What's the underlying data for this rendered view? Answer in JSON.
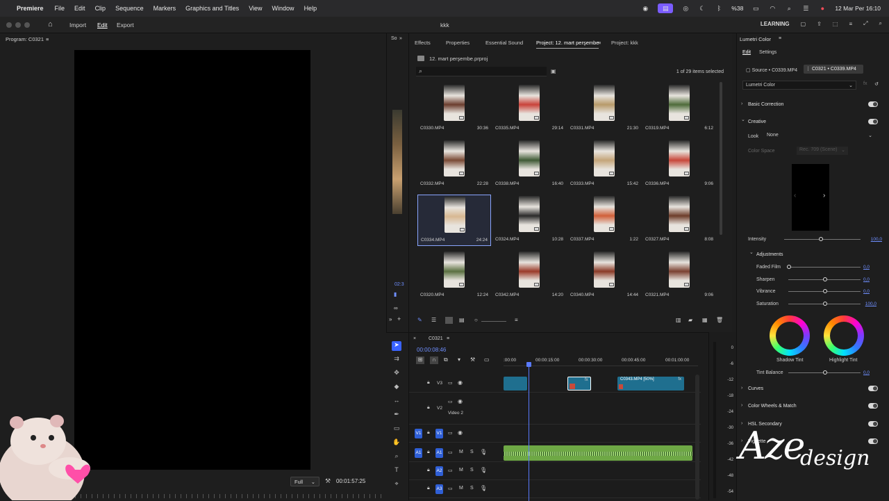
{
  "menubar": {
    "app_name": "Premiere",
    "menus": [
      "File",
      "Edit",
      "Clip",
      "Sequence",
      "Markers",
      "Graphics and Titles",
      "View",
      "Window",
      "Help"
    ],
    "battery": "%38",
    "datetime": "12 Mar Per 16:10"
  },
  "header": {
    "nav": [
      "Import",
      "Edit",
      "Export"
    ],
    "active_nav": "Edit",
    "project_title": "kkk",
    "workspace": "LEARNING"
  },
  "program": {
    "title": "Program: C0321",
    "zoom": "Full",
    "timecode": "00:01:57:25"
  },
  "strip": {
    "tab_label": "So",
    "timecode_partial": "02:3"
  },
  "project": {
    "tabs": [
      "Effects",
      "Properties",
      "Essential Sound",
      "Project: 12. mart perşembe",
      "Project: kkk"
    ],
    "active_tab": "Project: 12. mart perşembe",
    "project_file": "12. mart perşembe.prproj",
    "item_count": "1 of 29 items selected",
    "clips": [
      {
        "name": "C0330.MP4",
        "duration": "30:36",
        "color": "#6b3d2e"
      },
      {
        "name": "C0335.MP4",
        "duration": "29:14",
        "color": "#c9423a"
      },
      {
        "name": "C0331.MP4",
        "duration": "21:30",
        "color": "#b89a6a"
      },
      {
        "name": "C0319.MP4",
        "duration": "6:12",
        "color": "#4e6b3a"
      },
      {
        "name": "C0332.MP4",
        "duration": "22:28",
        "color": "#7a4a35"
      },
      {
        "name": "C0338.MP4",
        "duration": "16:40",
        "color": "#3f5a35"
      },
      {
        "name": "C0333.MP4",
        "duration": "15:42",
        "color": "#c4a57a"
      },
      {
        "name": "C0336.MP4",
        "duration": "9:06",
        "color": "#c8473a"
      },
      {
        "name": "C0334.MP4",
        "duration": "24:24",
        "color": "#d8b892"
      },
      {
        "name": "C0324.MP4",
        "duration": "10:28",
        "color": "#2a2a2a"
      },
      {
        "name": "C0337.MP4",
        "duration": "1:22",
        "color": "#d0603a"
      },
      {
        "name": "C0327.MP4",
        "duration": "8:08",
        "color": "#6d3d2a"
      },
      {
        "name": "C0320.MP4",
        "duration": "12:24",
        "color": "#5a7040"
      },
      {
        "name": "C0342.MP4",
        "duration": "14:20",
        "color": "#9a3a28"
      },
      {
        "name": "C0340.MP4",
        "duration": "14:44",
        "color": "#8a3a26"
      },
      {
        "name": "C0321.MP4",
        "duration": "9:06",
        "color": "#7a4030"
      }
    ],
    "selected_index": 8
  },
  "lumetri": {
    "title": "Lumetri Color",
    "subtabs": [
      "Edit",
      "Settings"
    ],
    "source_label": "Source • C0339.MP4",
    "sequence_label": "C0321 • C0339.MP4",
    "effect_select": "Lumetri Color",
    "basic_correction": "Basic Correction",
    "creative": "Creative",
    "look_label": "Look",
    "look_value": "None",
    "color_space_label": "Color Space",
    "color_space_value": "Rec. 709 (Scene)",
    "intensity_label": "Intensity",
    "intensity_value": "100,0",
    "adjustments": "Adjustments",
    "faded_film": "Faded Film",
    "faded_film_value": "0,0",
    "sharpen": "Sharpen",
    "sharpen_value": "0,0",
    "vibrance": "Vibrance",
    "vibrance_value": "0,0",
    "saturation": "Saturation",
    "saturation_value": "100,0",
    "shadow_tint": "Shadow Tint",
    "highlight_tint": "Highlight Tint",
    "tint_balance": "Tint Balance",
    "tint_balance_value": "0,0",
    "curves": "Curves",
    "color_wheels": "Color Wheels & Match",
    "secondary": "HSL Secondary",
    "vignette": "Vignette"
  },
  "timeline": {
    "sequence_name": "C0321",
    "timecode": "00:00:08:46",
    "ruler": [
      ":00:00",
      "00:00:15:00",
      "00:00:30:00",
      "00:00:45:00",
      "00:01:00:00"
    ],
    "tracks": {
      "v3": "V3",
      "v2": "V2",
      "v2_name": "Video 2",
      "v1": "V1",
      "a1": "A1",
      "a2": "A2",
      "a3": "A3"
    },
    "clip_label": "C0343.MP4 [50%]",
    "fx": "fx"
  },
  "meter": {
    "labels": [
      "0",
      "-6",
      "-12",
      "-18",
      "-24",
      "-30",
      "-36",
      "-42",
      "-48",
      "-54"
    ]
  },
  "watermark": {
    "main": "Aze",
    "script": "design"
  },
  "colors": {
    "accent": "#3a63ff",
    "timecode": "#6f8fff",
    "video_clip": "#1f6f8f",
    "audio_clip": "#6ea845"
  }
}
